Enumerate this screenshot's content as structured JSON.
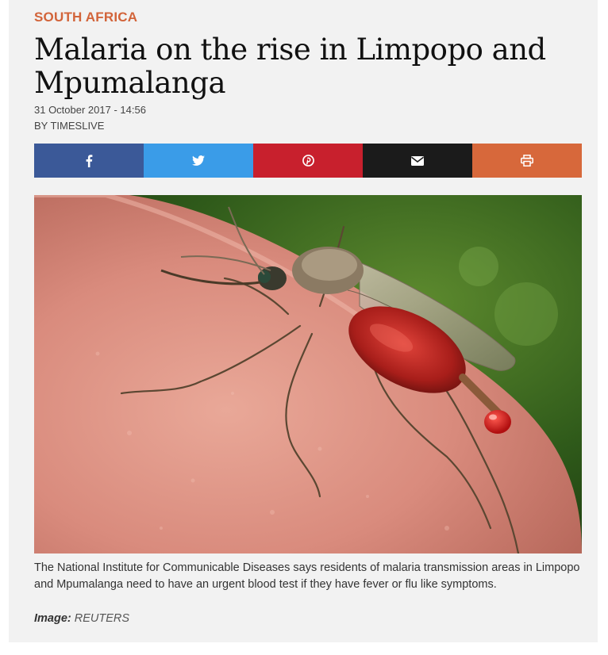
{
  "article": {
    "section": "SOUTH AFRICA",
    "headline": "Malaria on the rise in Limpopo and Mpumalanga",
    "dateline": "31 October 2017 - 14:56",
    "byline": "BY TIMESLIVE"
  },
  "share": {
    "buttons": [
      {
        "icon": "facebook-icon",
        "color": "#3b5998"
      },
      {
        "icon": "twitter-icon",
        "color": "#3a9ce8"
      },
      {
        "icon": "pinterest-icon",
        "color": "#c8202d"
      },
      {
        "icon": "envelope-icon",
        "color": "#1b1b1b"
      },
      {
        "icon": "print-icon",
        "color": "#d7683b"
      }
    ]
  },
  "figure": {
    "caption": "The National Institute for Communicable Diseases says residents of malaria transmission areas in Limpopo and Mpumalanga need to have an urgent blood test if they have fever or flu like symptoms.",
    "credit_label": "Image:",
    "credit_source": "REUTERS"
  },
  "colors": {
    "section_accent": "#d2643a",
    "background": "#f2f2f2"
  }
}
